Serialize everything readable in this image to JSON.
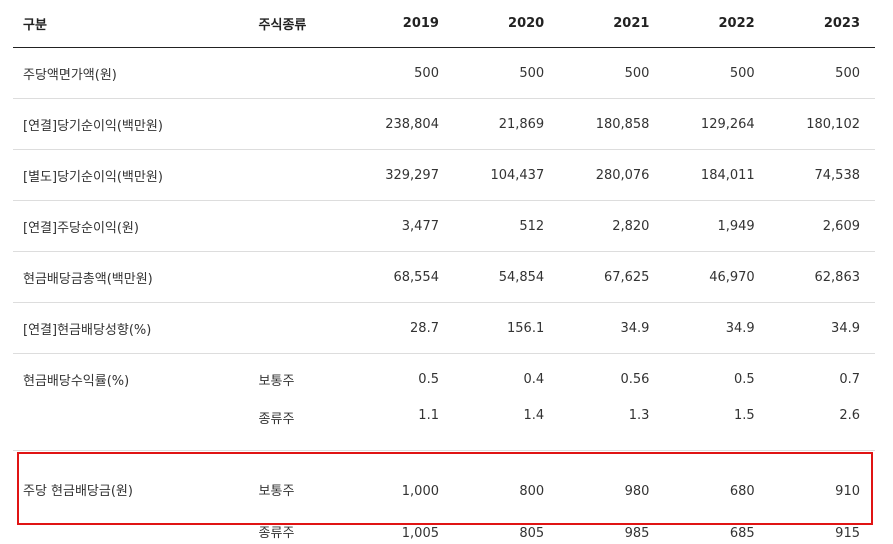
{
  "header": {
    "label": "구분",
    "type": "주식종류",
    "years": [
      "2019",
      "2020",
      "2021",
      "2022",
      "2023"
    ]
  },
  "rows": [
    {
      "label": "주당액면가액(원)",
      "type": "",
      "values": [
        "500",
        "500",
        "500",
        "500",
        "500"
      ]
    },
    {
      "label": "[연결]당기순이익(백만원)",
      "type": "",
      "values": [
        "238,804",
        "21,869",
        "180,858",
        "129,264",
        "180,102"
      ]
    },
    {
      "label": "[별도]당기순이익(백만원)",
      "type": "",
      "values": [
        "329,297",
        "104,437",
        "280,076",
        "184,011",
        "74,538"
      ]
    },
    {
      "label": "[연결]주당순이익(원)",
      "type": "",
      "values": [
        "3,477",
        "512",
        "2,820",
        "1,949",
        "2,609"
      ]
    },
    {
      "label": "현금배당금총액(백만원)",
      "type": "",
      "values": [
        "68,554",
        "54,854",
        "67,625",
        "46,970",
        "62,863"
      ]
    },
    {
      "label": "[연결]현금배당성향(%)",
      "type": "",
      "values": [
        "28.7",
        "156.1",
        "34.9",
        "34.9",
        "34.9"
      ]
    },
    {
      "label": "현금배당수익률(%)",
      "type": "보통주",
      "values": [
        "0.5",
        "0.4",
        "0.56",
        "0.5",
        "0.7"
      ]
    },
    {
      "label": "",
      "type": "종류주",
      "values": [
        "1.1",
        "1.4",
        "1.3",
        "1.5",
        "2.6"
      ]
    },
    {
      "label": "주당 현금배당금(원)",
      "type": "보통주",
      "values": [
        "1,000",
        "800",
        "980",
        "680",
        "910"
      ]
    },
    {
      "label": "",
      "type": "종류주",
      "values": [
        "1,005",
        "805",
        "985",
        "685",
        "915"
      ]
    }
  ],
  "colors": {
    "highlight": "#e01414",
    "header_rule": "#222222",
    "row_rule": "#dddddd"
  }
}
